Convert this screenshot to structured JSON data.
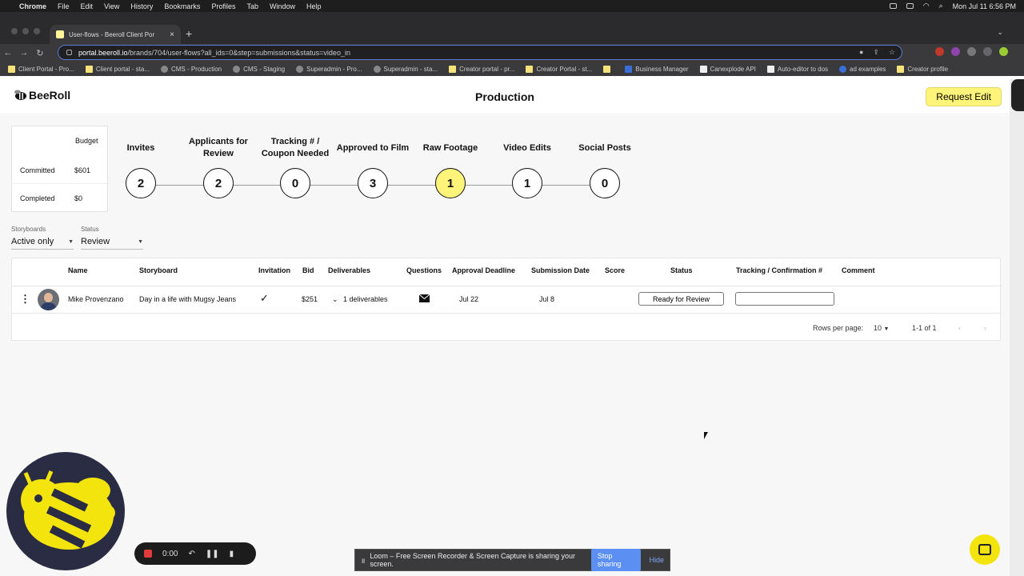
{
  "mac": {
    "app": "Chrome",
    "menus": [
      "File",
      "Edit",
      "View",
      "History",
      "Bookmarks",
      "Profiles",
      "Tab",
      "Window",
      "Help"
    ],
    "clock": "Mon Jul 11  6:56 PM"
  },
  "browser": {
    "tab_title": "User-flows - Beeroll Client Por",
    "url_host": "portal.beeroll.io",
    "url_path": "/brands/704/user-flows?all_ids=0&step=submissions&status=video_in",
    "bookmarks": [
      "Client Portal - Pro...",
      "Client portal - sta...",
      "CMS - Production",
      "CMS - Staging",
      "Superadmin - Pro...",
      "Superadmin - sta...",
      "Creator portal - pr...",
      "Creator Portal - st...",
      "",
      "Business Manager",
      "Canexplode API",
      "Auto-editor to dos",
      "ad examples",
      "Creator profile"
    ]
  },
  "header": {
    "logo": "BeeRoll",
    "title": "Production",
    "request_edit": "Request Edit"
  },
  "budget": {
    "header": "Budget",
    "committed_label": "Committed",
    "committed_value": "$601",
    "completed_label": "Completed",
    "completed_value": "$0"
  },
  "steps": [
    {
      "label": "Invites",
      "count": "2"
    },
    {
      "label": "Applicants for Review",
      "count": "2"
    },
    {
      "label": "Tracking # / Coupon Needed",
      "count": "0"
    },
    {
      "label": "Approved to Film",
      "count": "3"
    },
    {
      "label": "Raw Footage",
      "count": "1",
      "active": true
    },
    {
      "label": "Video Edits",
      "count": "1"
    },
    {
      "label": "Social Posts",
      "count": "0"
    }
  ],
  "filters": {
    "storyboards_label": "Storyboards",
    "storyboards_value": "Active only",
    "status_label": "Status",
    "status_value": "Review"
  },
  "table": {
    "columns": [
      "Name",
      "Storyboard",
      "Invitation",
      "Bid",
      "Deliverables",
      "Questions",
      "Approval Deadline",
      "Submission Date",
      "Score",
      "Status",
      "Tracking / Confirmation #",
      "Comment"
    ],
    "rows": [
      {
        "name": "Mike Provenzano",
        "storyboard": "Day in a life with Mugsy Jeans",
        "invitation": "✓",
        "bid": "$251",
        "deliverables": "1 deliverables",
        "approval_deadline": "Jul 22",
        "submission_date": "Jul 8",
        "score": "",
        "status": "Ready for Review",
        "tracking": "",
        "comment": ""
      }
    ],
    "rows_per_page_label": "Rows per page:",
    "rows_per_page": "10",
    "range": "1-1 of 1"
  },
  "loom": {
    "timer": "0:00",
    "share_text": "Loom – Free Screen Recorder & Screen Capture is sharing your screen.",
    "stop": "Stop sharing",
    "hide": "Hide"
  }
}
